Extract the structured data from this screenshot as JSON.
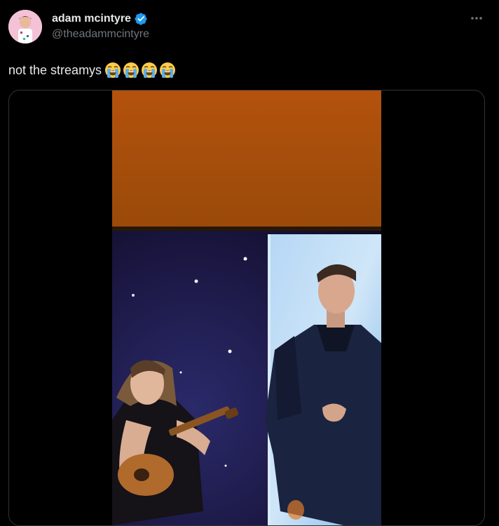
{
  "post": {
    "author": {
      "display_name": "adam mcintyre",
      "handle": "@theadammcintyre",
      "verified": true
    },
    "text": "not the streamys",
    "emojis": [
      "loudly-crying-face",
      "loudly-crying-face",
      "loudly-crying-face",
      "loudly-crying-face"
    ],
    "media": {
      "type": "video"
    }
  },
  "icons": {
    "verified": "verified-badge-icon",
    "more": "more-options-icon"
  },
  "colors": {
    "background": "#000000",
    "text_primary": "#e7e9ea",
    "text_secondary": "#71767b",
    "verified_blue": "#1d9bf0",
    "border": "#2f3336"
  }
}
